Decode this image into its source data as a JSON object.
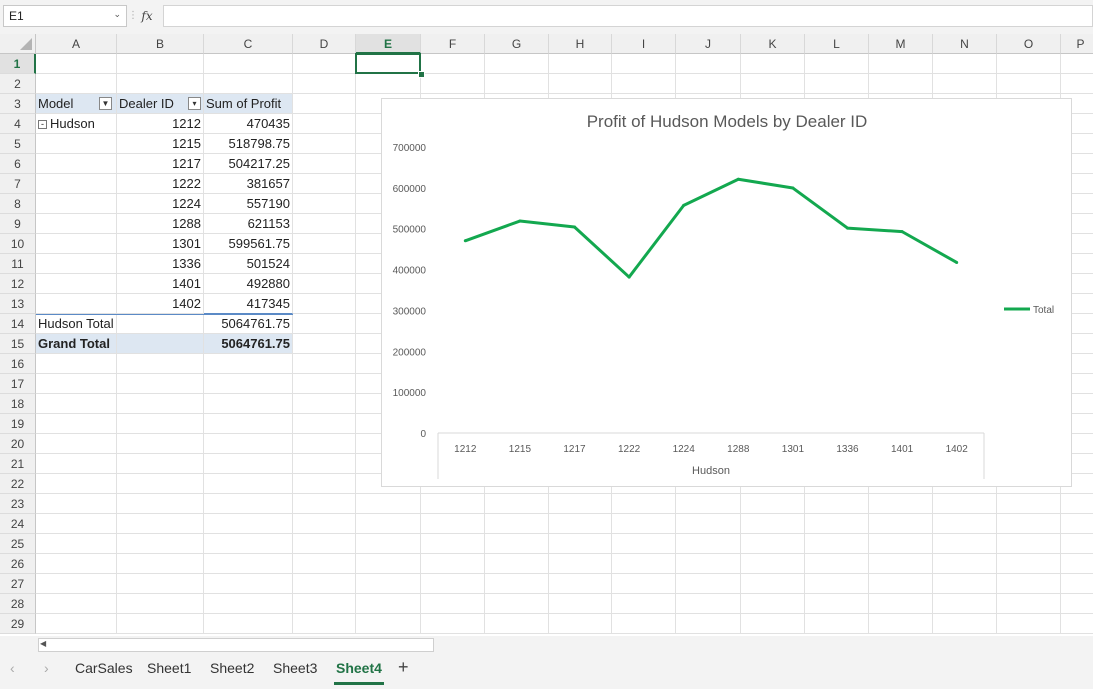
{
  "formula_bar": {
    "name_box": "E1",
    "fx_label": "fx",
    "formula": ""
  },
  "columns": [
    "A",
    "B",
    "C",
    "D",
    "E",
    "F",
    "G",
    "H",
    "I",
    "J",
    "K",
    "L",
    "M",
    "N",
    "O",
    "P"
  ],
  "rows": [
    "1",
    "2",
    "3",
    "4",
    "5",
    "6",
    "7",
    "8",
    "9",
    "10",
    "11",
    "12",
    "13",
    "14",
    "15",
    "16",
    "17",
    "18",
    "19",
    "20",
    "21",
    "22",
    "23",
    "24",
    "25",
    "26",
    "27",
    "28",
    "29"
  ],
  "pivot": {
    "header": {
      "model": "Model",
      "dealer": "Dealer ID",
      "profit": "Sum of Profit"
    },
    "group_label": "Hudson",
    "rows": [
      {
        "dealer": "1212",
        "profit": "470435"
      },
      {
        "dealer": "1215",
        "profit": "518798.75"
      },
      {
        "dealer": "1217",
        "profit": "504217.25"
      },
      {
        "dealer": "1222",
        "profit": "381657"
      },
      {
        "dealer": "1224",
        "profit": "557190"
      },
      {
        "dealer": "1288",
        "profit": "621153"
      },
      {
        "dealer": "1301",
        "profit": "599561.75"
      },
      {
        "dealer": "1336",
        "profit": "501524"
      },
      {
        "dealer": "1401",
        "profit": "492880"
      },
      {
        "dealer": "1402",
        "profit": "417345"
      }
    ],
    "subtotal": {
      "label": "Hudson Total",
      "value": "5064761.75"
    },
    "grandtotal": {
      "label": "Grand Total",
      "value": "5064761.75"
    }
  },
  "chart_data": {
    "type": "line",
    "title": "Profit of Hudson Models by Dealer ID",
    "categories": [
      "1212",
      "1215",
      "1217",
      "1222",
      "1224",
      "1288",
      "1301",
      "1336",
      "1401",
      "1402"
    ],
    "group_label": "Hudson",
    "series": [
      {
        "name": "Total",
        "color": "#13a84f",
        "values": [
          470435,
          518798.75,
          504217.25,
          381657,
          557190,
          621153,
          599561.75,
          501524,
          492880,
          417345
        ]
      }
    ],
    "ylim": [
      0,
      700000
    ],
    "yticks": [
      "0",
      "100000",
      "200000",
      "300000",
      "400000",
      "500000",
      "600000",
      "700000"
    ],
    "legend_position": "right",
    "grid": false
  },
  "sheets": {
    "tabs": [
      "CarSales",
      "Sheet1",
      "Sheet2",
      "Sheet3",
      "Sheet4"
    ],
    "active": "Sheet4",
    "add_label": "+"
  },
  "colors": {
    "accent": "#217346",
    "pivot_header": "#dde7f2",
    "line": "#13a84f"
  }
}
